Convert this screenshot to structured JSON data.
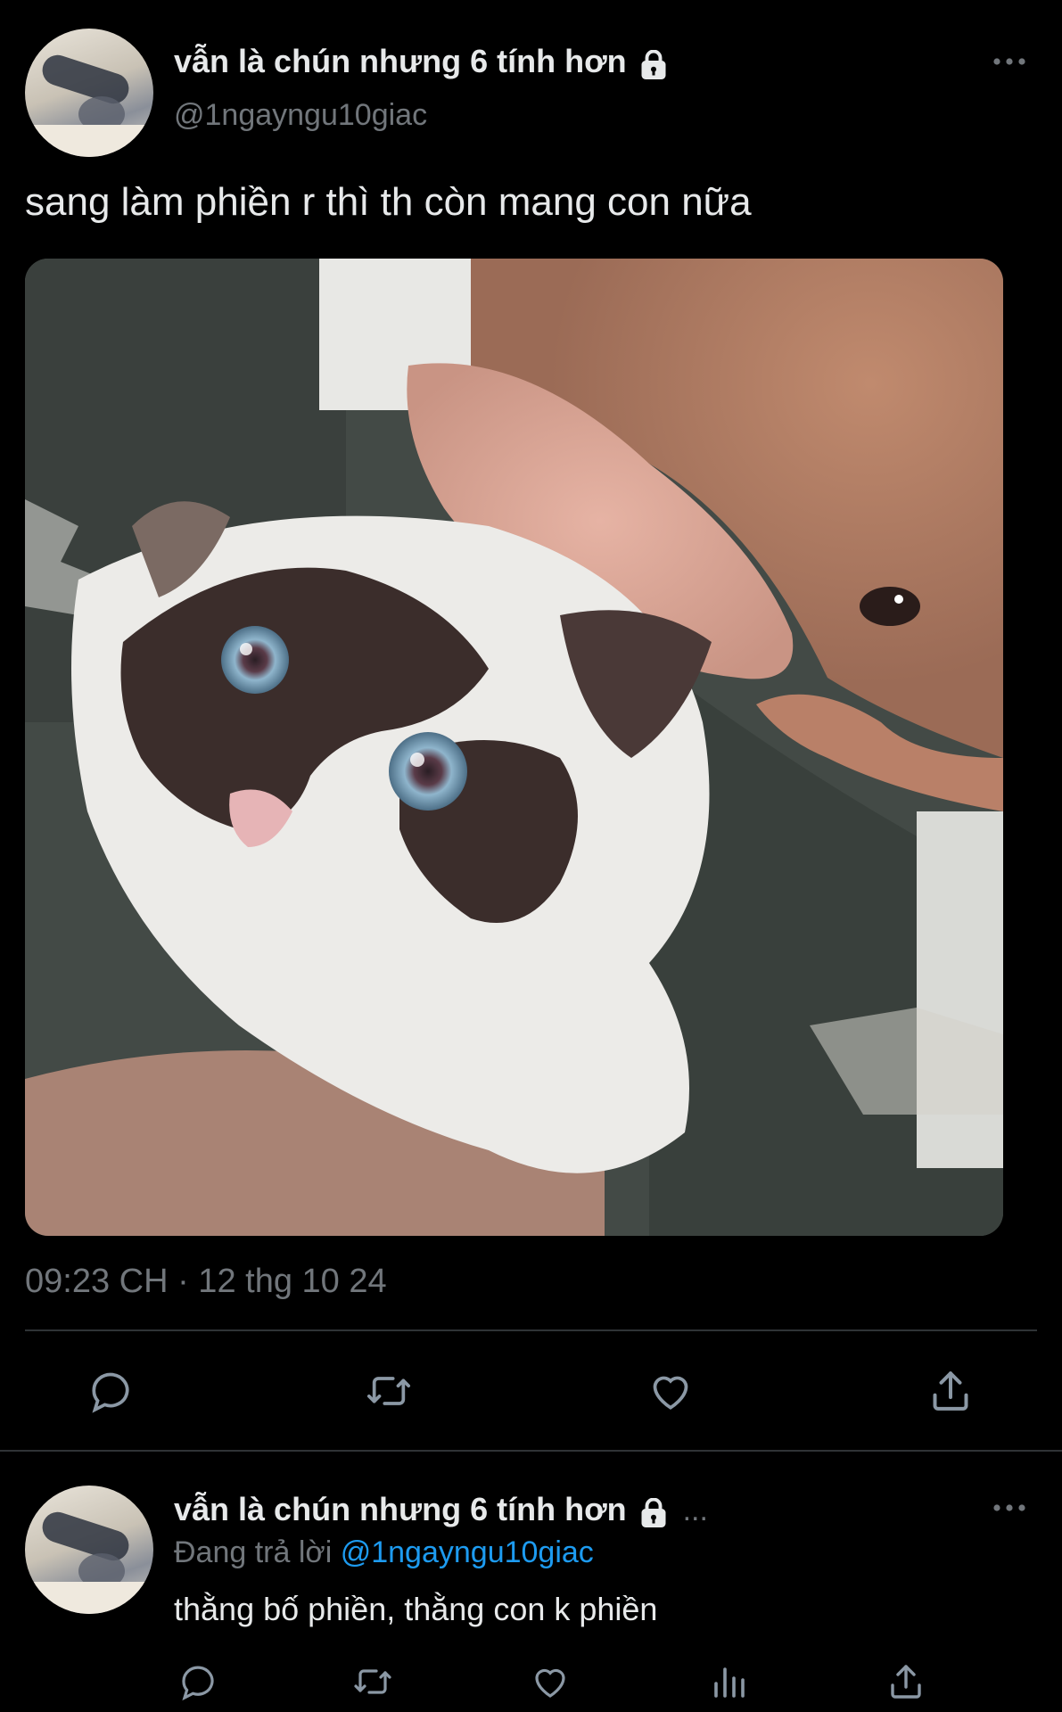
{
  "tweet": {
    "display_name": "vẫn là chún nhưng 6 tính hơn",
    "handle": "@1ngayngu10giac",
    "text": "sang làm phiền r thì th còn mang con nữa",
    "timestamp": "09:23 CH · 12 thg 10 24",
    "icons": {
      "lock": "lock-icon",
      "more": "more-icon",
      "actions": [
        "reply-icon",
        "retweet-icon",
        "like-icon",
        "share-icon"
      ]
    }
  },
  "reply": {
    "display_name": "vẫn là chún nhưng 6 tính hơn",
    "ellipsis": "...",
    "replying_prefix": "Đang trả lời",
    "replying_to": "@1ngayngu10giac",
    "text": "thằng bố phiền, thằng con k phiền",
    "icons": {
      "actions": [
        "reply-icon",
        "retweet-icon",
        "like-icon",
        "analytics-icon",
        "share-icon"
      ]
    }
  },
  "colors": {
    "background": "#000000",
    "text": "#e7e9ea",
    "muted": "#71767b",
    "link": "#1d9bf0",
    "divider": "#2f3336"
  }
}
